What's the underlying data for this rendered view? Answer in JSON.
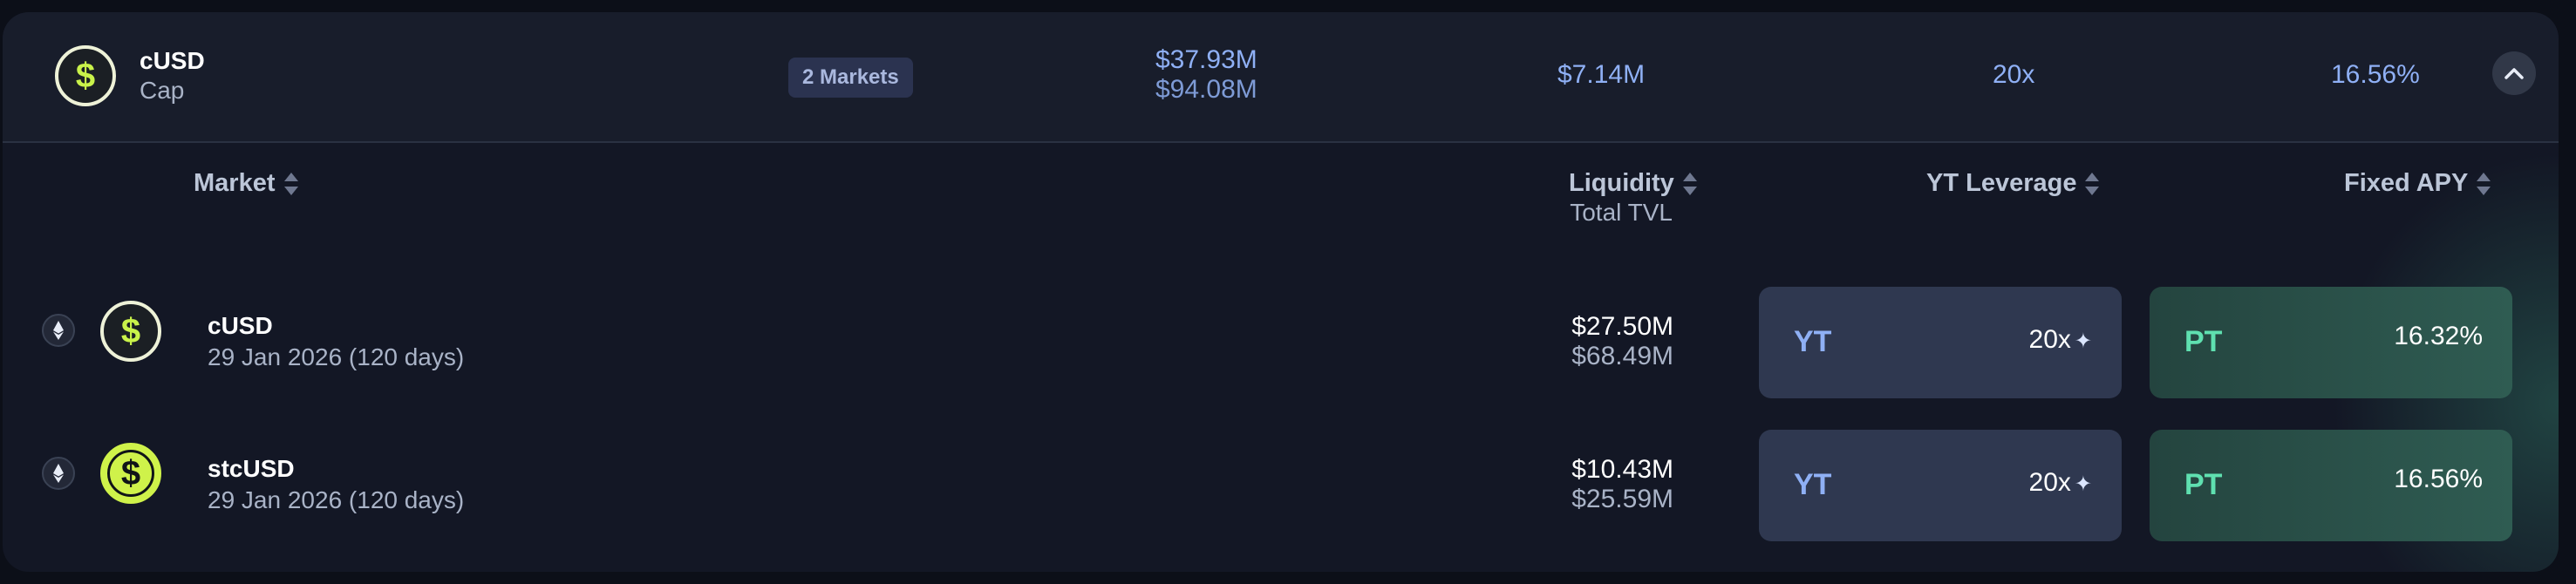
{
  "group": {
    "name": "cUSD",
    "subtitle": "Cap",
    "markets_badge": "2 Markets",
    "liquidity": "$37.93M",
    "total_tvl": "$94.08M",
    "volume": "$7.14M",
    "leverage": "20x",
    "apy": "16.56%"
  },
  "columns": {
    "market": "Market",
    "liquidity": "Liquidity",
    "total_tvl": "Total TVL",
    "yt_leverage": "YT Leverage",
    "fixed_apy": "Fixed APY"
  },
  "rows": [
    {
      "name": "cUSD",
      "date": "29 Jan 2026 (120 days)",
      "liquidity": "$27.50M",
      "total_tvl": "$68.49M",
      "yt_label": "YT",
      "yt_value": "20x",
      "pt_label": "PT",
      "pt_value": "16.32%"
    },
    {
      "name": "stcUSD",
      "date": "29 Jan 2026 (120 days)",
      "liquidity": "$10.43M",
      "total_tvl": "$25.59M",
      "yt_label": "YT",
      "yt_value": "20x",
      "pt_label": "PT",
      "pt_value": "16.56%"
    }
  ],
  "icons": {
    "coin_glyph": "$",
    "sparkle": "✦",
    "chain": "ethereum-icon",
    "collapse": "chevron-up-icon"
  },
  "colors": {
    "background": "#0c0f18",
    "card": "#131725",
    "accent_blue": "#8fb0f5",
    "accent_green": "#5fe0b0",
    "coin_lime": "#cff24a"
  }
}
